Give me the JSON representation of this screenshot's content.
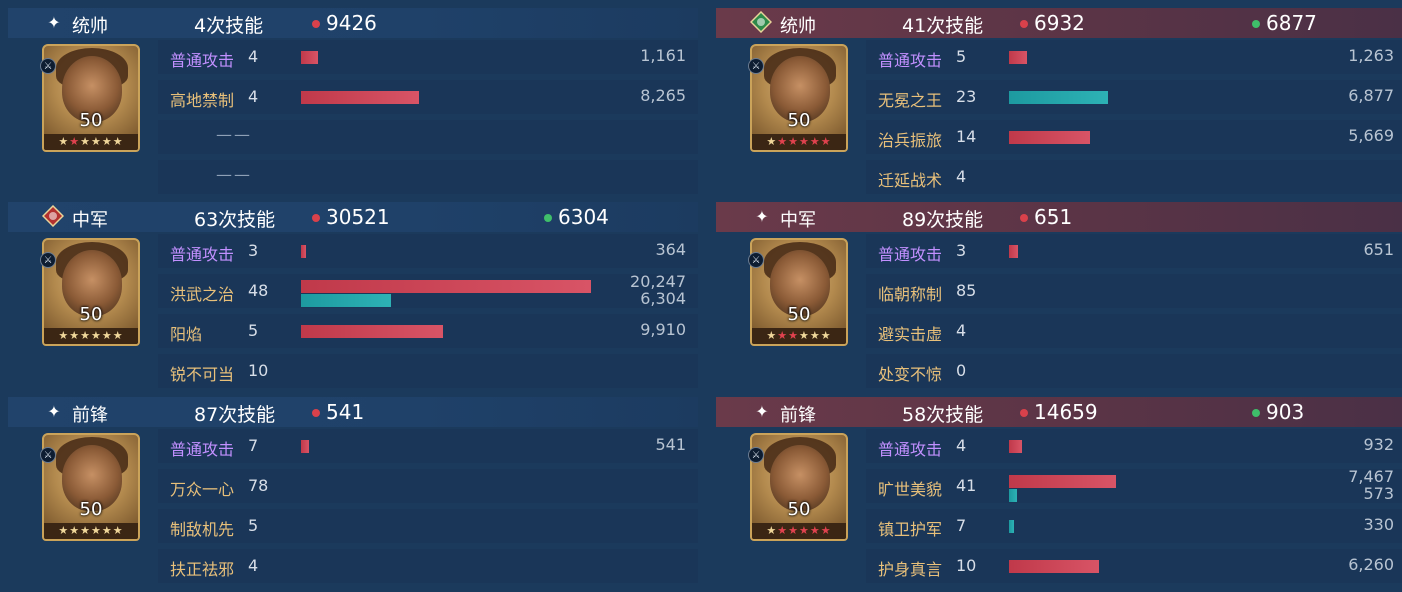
{
  "left": [
    {
      "role": "统帅",
      "icon": "sparkle-icon",
      "count": "4次技能",
      "damage": "9426",
      "heal": "",
      "level": "50",
      "stars": [
        {
          "s": "★",
          "r": false
        },
        {
          "s": "★",
          "r": true
        },
        {
          "s": "★",
          "r": false
        },
        {
          "s": "★",
          "r": false
        },
        {
          "s": "★",
          "r": false
        },
        {
          "s": "★",
          "r": false
        }
      ],
      "skills": [
        {
          "name": "普通攻击",
          "basic": true,
          "lvl": "4",
          "val": "1,161",
          "val2": "",
          "dmg": 1161,
          "heal": 0
        },
        {
          "name": "高地禁制",
          "basic": false,
          "lvl": "4",
          "val": "8,265",
          "val2": "",
          "dmg": 8265,
          "heal": 0
        },
        {
          "name": "",
          "basic": false,
          "lvl": "",
          "val": "",
          "val2": "",
          "dmg": 0,
          "heal": 0,
          "dash": "——"
        },
        {
          "name": "",
          "basic": false,
          "lvl": "",
          "val": "",
          "val2": "",
          "dmg": 0,
          "heal": 0,
          "dash": "——"
        }
      ]
    },
    {
      "role": "中军",
      "icon": "red-gem-icon",
      "count": "63次技能",
      "damage": "30521",
      "heal": "6304",
      "level": "50",
      "stars": [
        {
          "s": "★",
          "r": false
        },
        {
          "s": "★",
          "r": false
        },
        {
          "s": "★",
          "r": false
        },
        {
          "s": "★",
          "r": false
        },
        {
          "s": "★",
          "r": false
        },
        {
          "s": "★",
          "r": false
        }
      ],
      "skills": [
        {
          "name": "普通攻击",
          "basic": true,
          "lvl": "3",
          "val": "364",
          "val2": "",
          "dmg": 364,
          "heal": 0
        },
        {
          "name": "洪武之治",
          "basic": false,
          "lvl": "48",
          "val": "20,247",
          "val2": "6,304",
          "dmg": 20247,
          "heal": 6304
        },
        {
          "name": "阳焰",
          "basic": false,
          "lvl": "5",
          "val": "9,910",
          "val2": "",
          "dmg": 9910,
          "heal": 0
        },
        {
          "name": "锐不可当",
          "basic": false,
          "lvl": "10",
          "val": "",
          "val2": "",
          "dmg": 0,
          "heal": 0
        }
      ]
    },
    {
      "role": "前锋",
      "icon": "sparkle-icon",
      "count": "87次技能",
      "damage": "541",
      "heal": "",
      "level": "50",
      "stars": [
        {
          "s": "★",
          "r": false
        },
        {
          "s": "★",
          "r": false
        },
        {
          "s": "★",
          "r": false
        },
        {
          "s": "★",
          "r": false
        },
        {
          "s": "★",
          "r": false
        },
        {
          "s": "★",
          "r": false
        }
      ],
      "skills": [
        {
          "name": "普通攻击",
          "basic": true,
          "lvl": "7",
          "val": "541",
          "val2": "",
          "dmg": 541,
          "heal": 0
        },
        {
          "name": "万众一心",
          "basic": false,
          "lvl": "78",
          "val": "",
          "val2": "",
          "dmg": 0,
          "heal": 0
        },
        {
          "name": "制敌机先",
          "basic": false,
          "lvl": "5",
          "val": "",
          "val2": "",
          "dmg": 0,
          "heal": 0
        },
        {
          "name": "扶正祛邪",
          "basic": false,
          "lvl": "4",
          "val": "",
          "val2": "",
          "dmg": 0,
          "heal": 0
        }
      ]
    }
  ],
  "right": [
    {
      "role": "统帅",
      "icon": "green-gem-icon",
      "count": "41次技能",
      "damage": "6932",
      "heal": "6877",
      "level": "50",
      "stars": [
        {
          "s": "★",
          "r": false
        },
        {
          "s": "★",
          "r": true
        },
        {
          "s": "★",
          "r": true
        },
        {
          "s": "★",
          "r": true
        },
        {
          "s": "★",
          "r": true
        },
        {
          "s": "★",
          "r": true
        }
      ],
      "skills": [
        {
          "name": "普通攻击",
          "basic": true,
          "lvl": "5",
          "val": "1,263",
          "val2": "",
          "dmg": 1263,
          "heal": 0
        },
        {
          "name": "无冕之王",
          "basic": false,
          "lvl": "23",
          "val": "6,877",
          "val2": "",
          "dmg": 0,
          "heal": 6877
        },
        {
          "name": "治兵振旅",
          "basic": false,
          "lvl": "14",
          "val": "5,669",
          "val2": "",
          "dmg": 5669,
          "heal": 0
        },
        {
          "name": "迁延战术",
          "basic": false,
          "lvl": "4",
          "val": "",
          "val2": "",
          "dmg": 0,
          "heal": 0
        }
      ]
    },
    {
      "role": "中军",
      "icon": "sparkle-icon",
      "count": "89次技能",
      "damage": "651",
      "heal": "",
      "level": "50",
      "stars": [
        {
          "s": "★",
          "r": false
        },
        {
          "s": "★",
          "r": true
        },
        {
          "s": "★",
          "r": true
        },
        {
          "s": "★",
          "r": false
        },
        {
          "s": "★",
          "r": false
        },
        {
          "s": "★",
          "r": false
        }
      ],
      "skills": [
        {
          "name": "普通攻击",
          "basic": true,
          "lvl": "3",
          "val": "651",
          "val2": "",
          "dmg": 651,
          "heal": 0
        },
        {
          "name": "临朝称制",
          "basic": false,
          "lvl": "85",
          "val": "",
          "val2": "",
          "dmg": 0,
          "heal": 0
        },
        {
          "name": "避实击虚",
          "basic": false,
          "lvl": "4",
          "val": "",
          "val2": "",
          "dmg": 0,
          "heal": 0
        },
        {
          "name": "处变不惊",
          "basic": false,
          "lvl": "0",
          "val": "",
          "val2": "",
          "dmg": 0,
          "heal": 0
        }
      ]
    },
    {
      "role": "前锋",
      "icon": "sparkle-icon",
      "count": "58次技能",
      "damage": "14659",
      "heal": "903",
      "level": "50",
      "stars": [
        {
          "s": "★",
          "r": false
        },
        {
          "s": "★",
          "r": true
        },
        {
          "s": "★",
          "r": true
        },
        {
          "s": "★",
          "r": true
        },
        {
          "s": "★",
          "r": true
        },
        {
          "s": "★",
          "r": true
        }
      ],
      "skills": [
        {
          "name": "普通攻击",
          "basic": true,
          "lvl": "4",
          "val": "932",
          "val2": "",
          "dmg": 932,
          "heal": 0
        },
        {
          "name": "旷世美貌",
          "basic": false,
          "lvl": "41",
          "val": "7,467",
          "val2": "573",
          "dmg": 7467,
          "heal": 573
        },
        {
          "name": "镇卫护军",
          "basic": false,
          "lvl": "7",
          "val": "330",
          "val2": "",
          "dmg": 0,
          "heal": 330
        },
        {
          "name": "护身真言",
          "basic": false,
          "lvl": "10",
          "val": "6,260",
          "val2": "",
          "dmg": 6260,
          "heal": 0
        }
      ]
    }
  ],
  "colors": {
    "damage": "#d9414b",
    "heal": "#2db2b5",
    "basic_skill": "#c290ff",
    "skill": "#e8c07a"
  }
}
